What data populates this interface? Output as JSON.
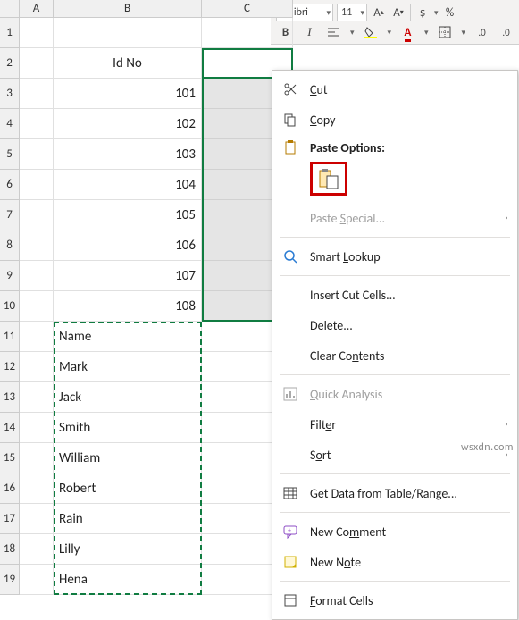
{
  "ribbon": {
    "font_name": "Calibri",
    "font_size": "11",
    "currency": "$",
    "percent": "%"
  },
  "columns": [
    "A",
    "B",
    "C"
  ],
  "rows": [
    "1",
    "2",
    "3",
    "4",
    "5",
    "6",
    "7",
    "8",
    "9",
    "10",
    "11",
    "12",
    "13",
    "14",
    "15",
    "16",
    "17",
    "18",
    "19"
  ],
  "b_col": {
    "header": "Id No",
    "ids": [
      "101",
      "102",
      "103",
      "104",
      "105",
      "106",
      "107",
      "108"
    ],
    "names": [
      "Name",
      "Mark",
      "Jack",
      "Smith",
      "William",
      "Robert",
      "Rain",
      "Lilly",
      "Hena"
    ]
  },
  "ctx": {
    "cut": "Cut",
    "copy": "Copy",
    "paste_options": "Paste Options:",
    "paste_special": "Paste Special...",
    "smart_lookup": "Smart Lookup",
    "insert_cut": "Insert Cut Cells...",
    "delete": "Delete...",
    "clear_contents": "Clear Contents",
    "quick_analysis": "Quick Analysis",
    "filter": "Filter",
    "sort": "Sort",
    "get_data": "Get Data from Table/Range...",
    "new_comment": "New Comment",
    "new_note": "New Note",
    "format_cells": "Format Cells"
  },
  "watermark": "wsxdn.com"
}
